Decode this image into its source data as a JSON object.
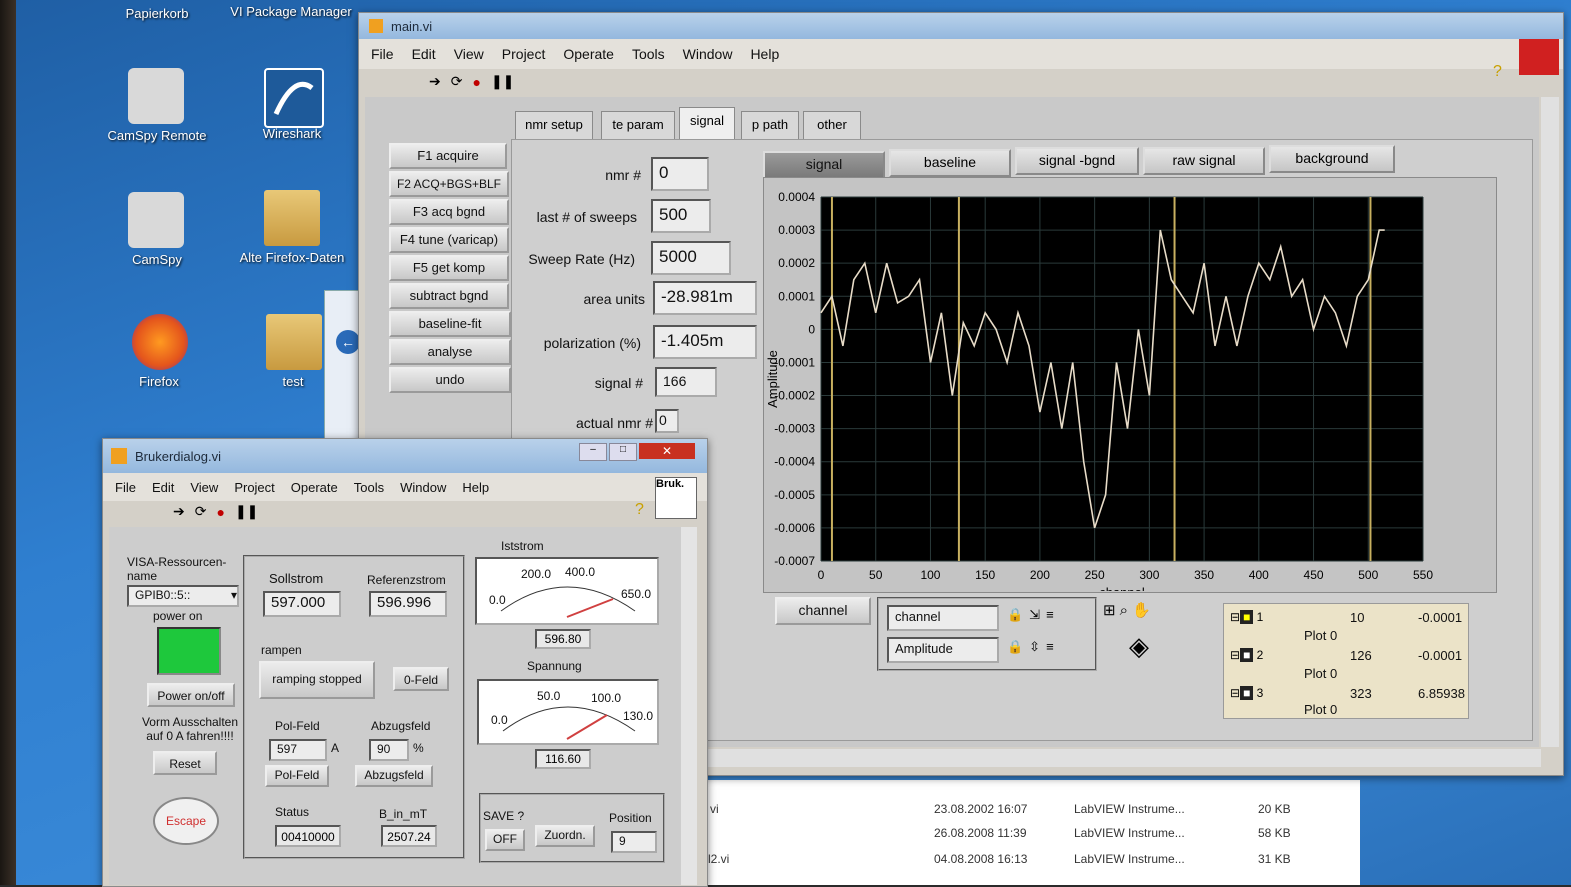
{
  "desktop": {
    "icons": [
      {
        "label": "Papierkorb"
      },
      {
        "label": "VI Package Manager"
      },
      {
        "label": "CamSpy Remote"
      },
      {
        "label": "Wireshark"
      },
      {
        "label": "CamSpy"
      },
      {
        "label": "Alte Firefox-Daten"
      },
      {
        "label": "Firefox"
      },
      {
        "label": "test"
      }
    ]
  },
  "main": {
    "title": "main.vi",
    "menu": [
      "File",
      "Edit",
      "View",
      "Project",
      "Operate",
      "Tools",
      "Window",
      "Help"
    ],
    "tabs": [
      "nmr setup",
      "te param",
      "signal",
      "p path",
      "other"
    ],
    "selected_tab": "signal",
    "fkeys": [
      "F1 acquire",
      "F2 ACQ+BGS+BLF",
      "F3 acq bgnd",
      "F4 tune (varicap)",
      "F5 get komp",
      "subtract bgnd",
      "baseline-fit",
      "analyse",
      "undo"
    ],
    "fields": {
      "nmr_label": "nmr #",
      "nmr_value": "0",
      "sweeps_label": "last # of sweeps",
      "sweeps_value": "500",
      "rate_label": "Sweep Rate (Hz)",
      "rate_value": "5000",
      "area_label": "area units",
      "area_value": "-28.981m",
      "pol_label": "polarization (%)",
      "pol_value": "-1.405m",
      "signal_label": "signal #",
      "signal_value": "166",
      "actual_label": "actual nmr #",
      "actual_value": "0"
    },
    "plot_tabs": [
      "signal",
      "baseline",
      "signal -bgnd",
      "raw signal",
      "background"
    ],
    "scale_legend": {
      "x_name": "channel",
      "y_name": "Amplitude",
      "x_button": "channel"
    },
    "plot_legend": [
      {
        "num": "1",
        "name": "Plot 0",
        "a": "10",
        "b": "-0.0001"
      },
      {
        "num": "2",
        "name": "Plot 0",
        "a": "126",
        "b": "-0.0001"
      },
      {
        "num": "3",
        "name": "Plot 0",
        "a": "323",
        "b": "6.85938"
      }
    ]
  },
  "chart_data": {
    "type": "line",
    "xlabel": "channel",
    "ylabel": "Amplitude",
    "xlim": [
      0,
      550
    ],
    "ylim": [
      -0.0007,
      0.0004
    ],
    "x_ticks": [
      0,
      50,
      100,
      150,
      200,
      250,
      300,
      350,
      400,
      450,
      500,
      550
    ],
    "y_tick_labels": [
      "0.0004",
      "0.0003",
      "0.0002",
      "0.0001",
      "0",
      "-0.0001",
      "-0.0002",
      "-0.0003",
      "-0.0004",
      "-0.0005",
      "-0.0006",
      "-0.0007"
    ],
    "y_ticks": [
      0.0004,
      0.0003,
      0.0002,
      0.0001,
      0,
      -0.0001,
      -0.0002,
      -0.0003,
      -0.0004,
      -0.0005,
      -0.0006,
      -0.0007
    ],
    "cursors_x": [
      10,
      126,
      323,
      502
    ],
    "grid": true,
    "background": "#000000",
    "line_color": "#e8dcc8",
    "cursor_color": "#c8b060",
    "series": [
      {
        "x": [
          0,
          10,
          20,
          30,
          40,
          50,
          60,
          70,
          80,
          90,
          100,
          110,
          120,
          130,
          140,
          150,
          160,
          170,
          180,
          190,
          200,
          210,
          220,
          230,
          240,
          250,
          260,
          270,
          280,
          290,
          300,
          310,
          320,
          330,
          340,
          350,
          360,
          370,
          380,
          390,
          400,
          410,
          420,
          430,
          440,
          450,
          460,
          470,
          480,
          490,
          500,
          510,
          515
        ],
        "values": [
          5e-05,
          0.0001,
          -5e-05,
          0.00015,
          0.0002,
          5e-05,
          0.0002,
          8e-05,
          0.0001,
          0.00015,
          -0.0001,
          5e-05,
          -0.0002,
          2e-05,
          -5e-05,
          5e-05,
          0.0,
          -0.0001,
          5e-05,
          -5e-05,
          -0.00025,
          -0.0001,
          -0.0003,
          -0.0001,
          -0.0004,
          -0.0006,
          -0.0005,
          -0.0001,
          -0.0003,
          0.0,
          -0.0002,
          0.0003,
          0.00015,
          0.0001,
          5e-05,
          0.0002,
          -5e-05,
          0.0001,
          -5e-05,
          0.0001,
          0.0002,
          0.00015,
          0.00025,
          0.0001,
          0.00015,
          0.0,
          0.0001,
          5e-05,
          -5e-05,
          0.0001,
          0.00015,
          0.0003,
          0.0003
        ]
      }
    ]
  },
  "bruker": {
    "title": "Brukerdialog.vi",
    "menu": [
      "File",
      "Edit",
      "View",
      "Project",
      "Operate",
      "Tools",
      "Window",
      "Help"
    ],
    "logo_text": "Bruk.",
    "visa_label": "VISA-Ressourcen-name",
    "visa_value": "GPIB0::5::",
    "power_on_label": "power on",
    "power_btn": "Power on/off",
    "warn_text": "Vorm Ausschalten auf 0 A fahren!!!!",
    "reset_btn": "Reset",
    "escape_btn": "Escape",
    "sollstrom_label": "Sollstrom",
    "sollstrom_value": "597.000",
    "referenzstrom_label": "Referenzstrom",
    "referenzstrom_value": "596.996",
    "rampen_label": "rampen",
    "ramping_btn": "ramping stopped",
    "zero_btn": "0-Feld",
    "polfeld_label": "Pol-Feld",
    "polfeld_value": "597",
    "polfeld_unit": "A",
    "abzug_label": "Abzugsfeld",
    "abzug_value": "90",
    "abzug_unit": "%",
    "polfeld_btn": "Pol-Feld",
    "abzug_btn": "Abzugsfeld",
    "status_label": "Status",
    "status_value": "00410000",
    "bmt_label": "B_in_mT",
    "bmt_value": "2507.24",
    "iststrom_label": "Iststrom",
    "iststrom_ticks": [
      "0.0",
      "200.0",
      "400.0",
      "650.0"
    ],
    "iststrom_value": "596.80",
    "spannung_label": "Spannung",
    "spannung_ticks": [
      "0.0",
      "50.0",
      "100.0",
      "130.0"
    ],
    "spannung_value": "116.60",
    "save_label": "SAVE ?",
    "save_btn": "OFF",
    "zuordn_btn": "Zuordn.",
    "position_label": "Position",
    "position_value": "9"
  },
  "filelist": {
    "rows": [
      {
        "name": "vi",
        "date": "23.08.2002 16:07",
        "type": "LabVIEW Instrume...",
        "size": "20 KB"
      },
      {
        "name": "",
        "date": "26.08.2008 11:39",
        "type": "LabVIEW Instrume...",
        "size": "58 KB"
      },
      {
        "name": "l2.vi",
        "date": "04.08.2008 16:13",
        "type": "LabVIEW Instrume...",
        "size": "31 KB"
      }
    ]
  }
}
